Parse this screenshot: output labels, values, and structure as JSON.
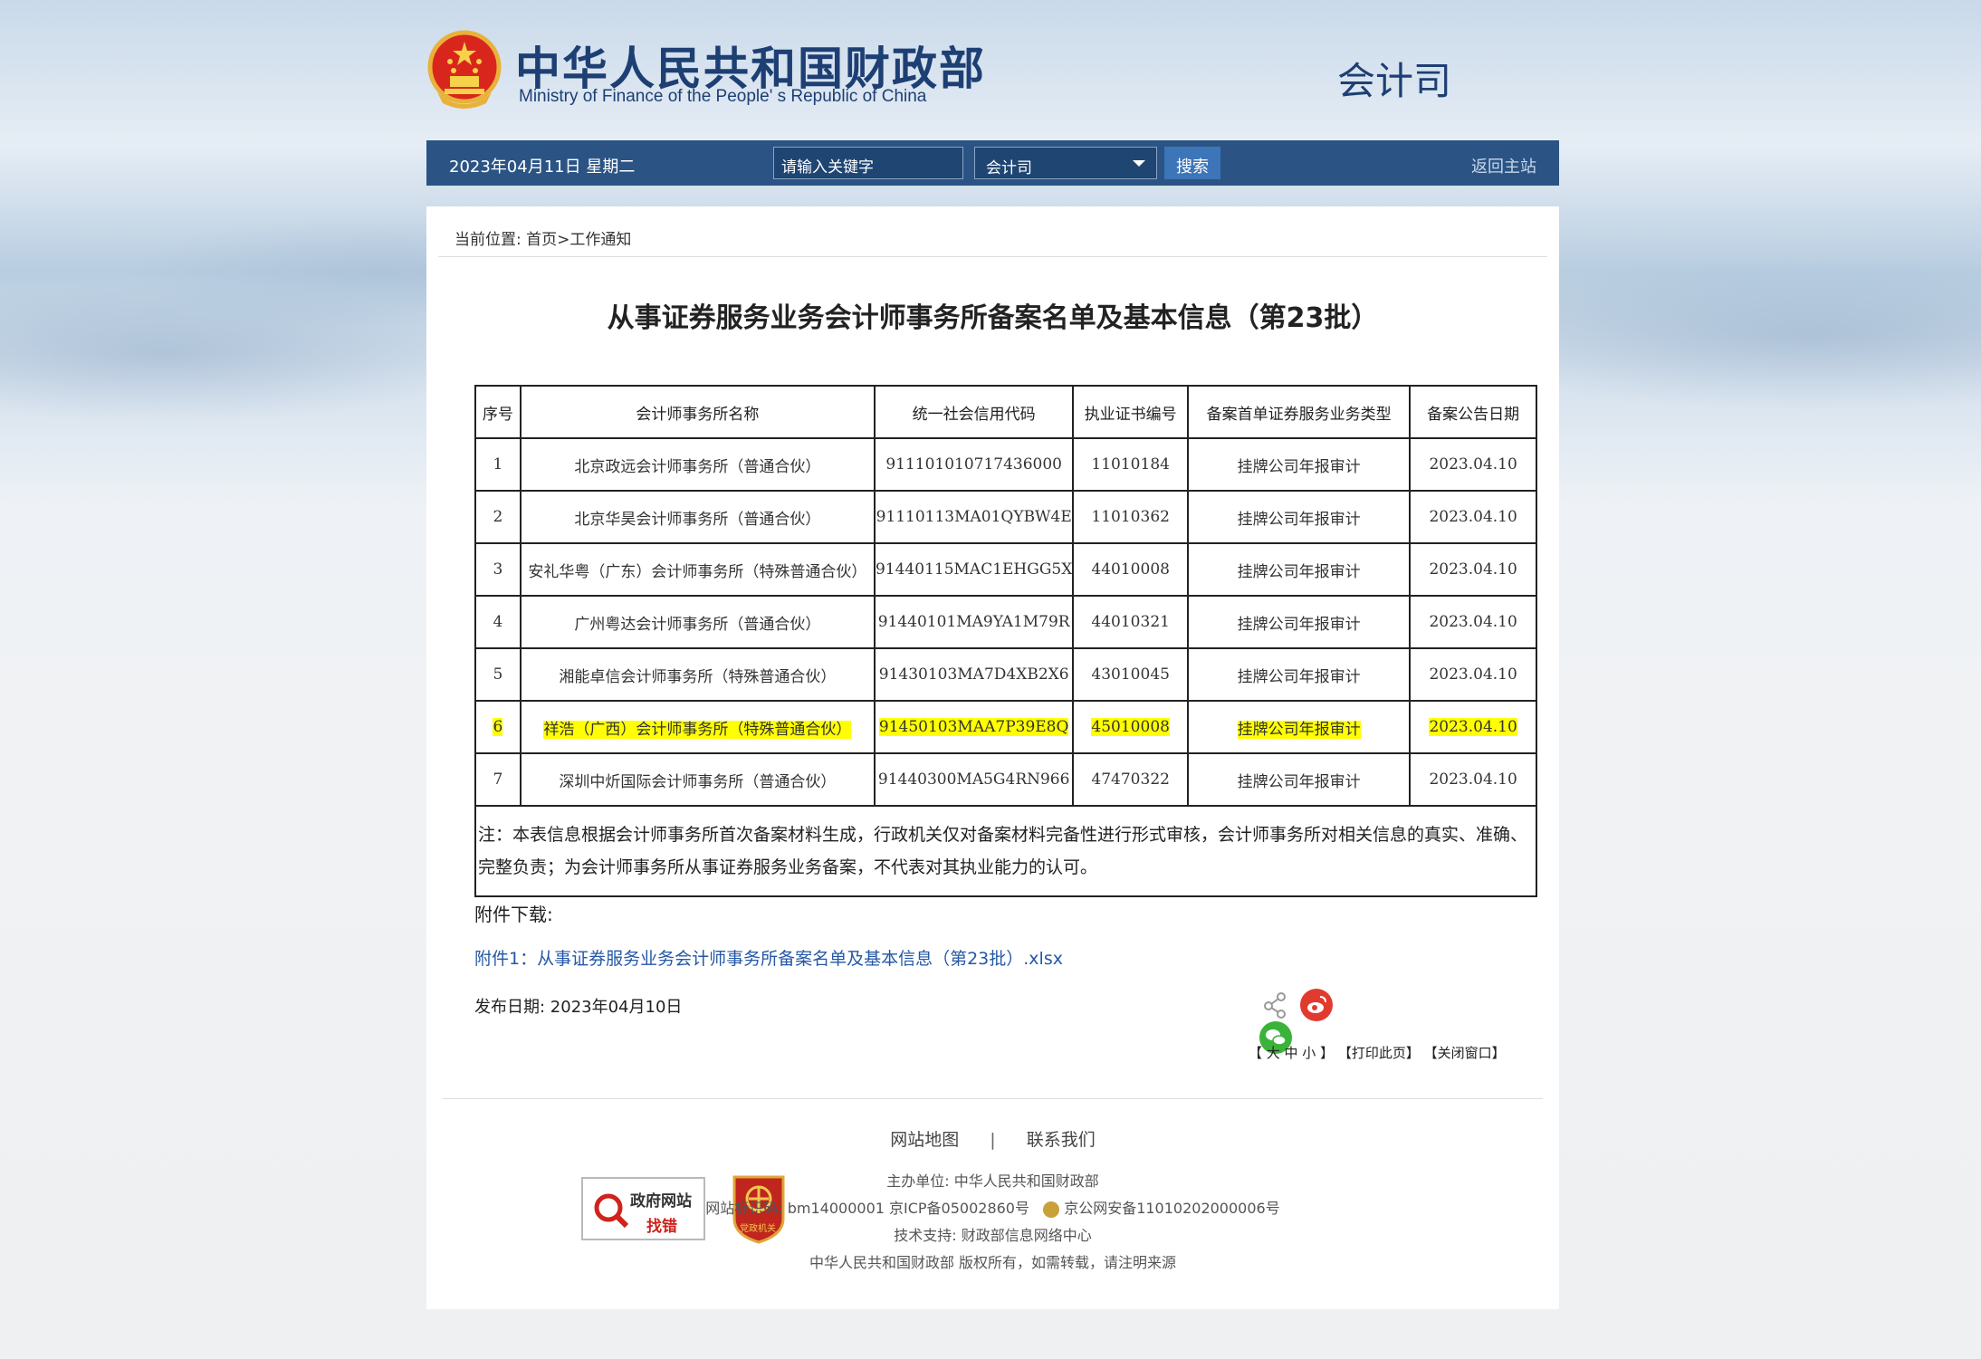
{
  "header": {
    "title_cn": "中华人民共和国财政部",
    "title_en": "Ministry of Finance of the People' s Republic of China",
    "department": "会计司"
  },
  "navbar": {
    "date": "2023年04月11日  星期二",
    "search_placeholder": "请输入关键字",
    "scope_selected": "会计司",
    "search_button": "搜索",
    "home_link": "返回主站"
  },
  "breadcrumb": {
    "label": "当前位置: ",
    "home": "首页",
    "sep": ">",
    "current": "工作通知"
  },
  "article": {
    "title": "从事证券服务业务会计师事务所备案名单及基本信息（第23批）",
    "table": {
      "headers": [
        "序号",
        "会计师事务所名称",
        "统一社会信用代码",
        "执业证书编号",
        "备案首单证券服务业务类型",
        "备案公告日期"
      ],
      "rows": [
        [
          "1",
          "北京政远会计师事务所（普通合伙）",
          "911101010717436000",
          "11010184",
          "挂牌公司年报审计",
          "2023.04.10"
        ],
        [
          "2",
          "北京华昊会计师事务所（普通合伙）",
          "91110113MA01QYBW4E",
          "11010362",
          "挂牌公司年报审计",
          "2023.04.10"
        ],
        [
          "3",
          "安礼华粤（广东）会计师事务所（特殊普通合伙）",
          "91440115MAC1EHGG5X",
          "44010008",
          "挂牌公司年报审计",
          "2023.04.10"
        ],
        [
          "4",
          "广州粤达会计师事务所（普通合伙）",
          "91440101MA9YA1M79R",
          "44010321",
          "挂牌公司年报审计",
          "2023.04.10"
        ],
        [
          "5",
          "湘能卓信会计师事务所（特殊普通合伙）",
          "91430103MA7D4XB2X6",
          "43010045",
          "挂牌公司年报审计",
          "2023.04.10"
        ],
        [
          "6",
          "祥浩（广西）会计师事务所（特殊普通合伙）",
          "91450103MAA7P39E8Q",
          "45010008",
          "挂牌公司年报审计",
          "2023.04.10"
        ],
        [
          "7",
          "深圳中炘国际会计师事务所（普通合伙）",
          "91440300MA5G4RN966",
          "47470322",
          "挂牌公司年报审计",
          "2023.04.10"
        ]
      ],
      "note": "注：本表信息根据会计师事务所首次备案材料生成，行政机关仅对备案材料完备性进行形式审核，会计师事务所对相关信息的真实、准确、完整负责；为会计师事务所从事证券服务业务备案，不代表对其执业能力的认可。"
    },
    "attachment_label": "附件下载:",
    "attachment_link": "附件1：从事证券服务业务会计师事务所备案名单及基本信息（第23批）.xlsx",
    "publish_date": "发布日期:  2023年04月10日",
    "tools": {
      "font_size": "【 大 中 小 】",
      "print": "【打印此页】",
      "close": "【关闭窗口】"
    }
  },
  "footer": {
    "sitemap": "网站地图",
    "divider": "|",
    "contact": "联系我们",
    "sponsor": "主办单位:  中华人民共和国财政部",
    "site_id": "网站标识码:  bm14000001   京ICP备05002860号",
    "police": "京公网安备11010202000006号",
    "tech": "技术支持:  财政部信息网络中心",
    "copyright": "中华人民共和国财政部  版权所有，如需转载，请注明来源",
    "badge_gov_line1": "政府网站",
    "badge_gov_line2": "找错",
    "badge_party": "党政机关"
  },
  "icons": [
    "national-emblem-icon",
    "share-icon",
    "weibo-icon",
    "wechat-icon",
    "police-badge-icon",
    "magnifier-icon"
  ],
  "colors": {
    "brand_blue": "#2b5485",
    "title_blue": "#1d3f73",
    "link_blue": "#2557a7",
    "highlight": "#ffff00"
  }
}
